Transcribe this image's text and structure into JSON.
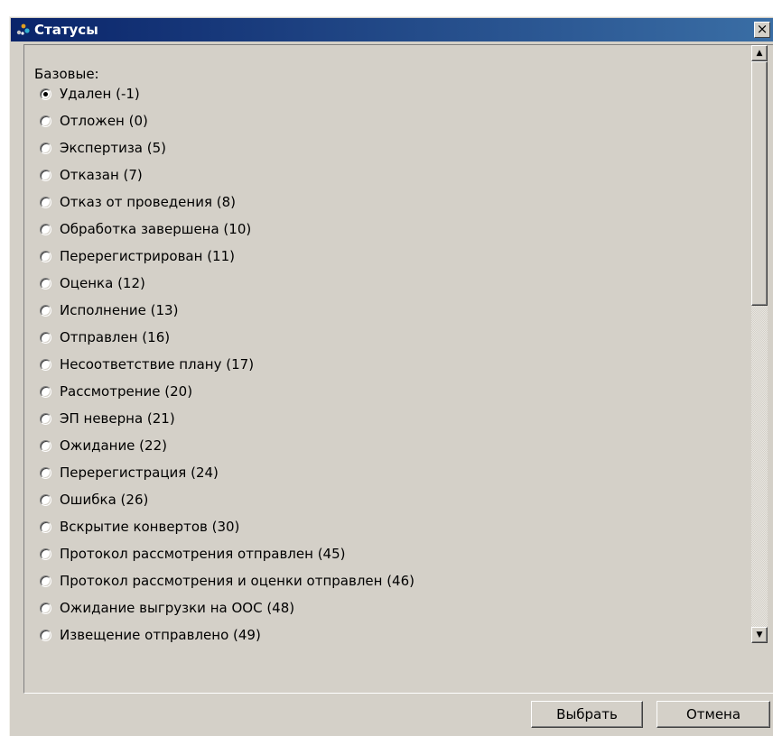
{
  "window": {
    "title": "Статусы",
    "close_label": "×",
    "title_icon": "app-icon"
  },
  "group": {
    "label": "Базовые:",
    "selected_index": 0,
    "items": [
      "Удален (-1)",
      "Отложен (0)",
      "Экспертиза (5)",
      "Отказан (7)",
      "Отказ от проведения (8)",
      "Обработка завершена (10)",
      "Перерегистрирован (11)",
      "Оценка (12)",
      "Исполнение (13)",
      "Отправлен (16)",
      "Несоответствие плану (17)",
      "Рассмотрение (20)",
      "ЭП неверна (21)",
      "Ожидание (22)",
      "Перерегистрация (24)",
      "Ошибка (26)",
      "Вскрытие конвертов (30)",
      "Протокол рассмотрения отправлен (45)",
      "Протокол рассмотрения и оценки отправлен (46)",
      "Ожидание выгрузки на ООС (48)",
      "Извещение отправлено (49)"
    ]
  },
  "scrollbar": {
    "up_icon": "▲",
    "down_icon": "▼"
  },
  "buttons": {
    "select": "Выбрать",
    "cancel": "Отмена"
  }
}
